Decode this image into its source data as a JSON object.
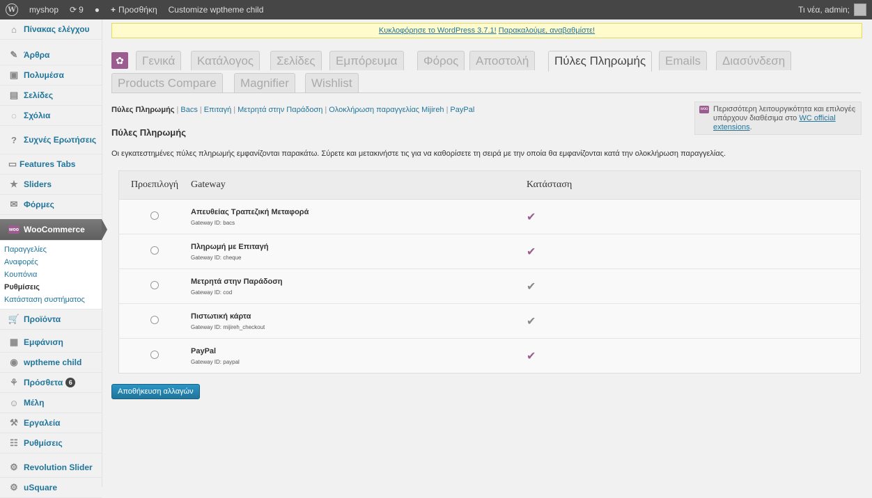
{
  "adminbar": {
    "site_name": "myshop",
    "updates_count": "9",
    "new_label": "Προσθήκη",
    "customize_label": "Customize wptheme child",
    "greeting": "Τι νέα, admin;"
  },
  "sidebar": {
    "items": [
      {
        "label": "Πίνακας ελέγχου",
        "icon": "home-icon"
      },
      {
        "label": "Άρθρα",
        "icon": "pin-icon"
      },
      {
        "label": "Πολυμέσα",
        "icon": "media-icon"
      },
      {
        "label": "Σελίδες",
        "icon": "pages-icon"
      },
      {
        "label": "Σχόλια",
        "icon": "comments-icon"
      },
      {
        "label": "Συχνές Ερωτήσεις",
        "icon": "faq-icon"
      },
      {
        "label": "Features Tabs",
        "icon": "tabs-icon"
      },
      {
        "label": "Sliders",
        "icon": "star-icon"
      },
      {
        "label": "Φόρμες",
        "icon": "mail-icon"
      },
      {
        "label": "WooCommerce",
        "icon": "woo-icon"
      },
      {
        "label": "Προϊόντα",
        "icon": "cart-icon"
      },
      {
        "label": "Εμφάνιση",
        "icon": "appearance-icon"
      },
      {
        "label": "wptheme child",
        "icon": "theme-icon"
      },
      {
        "label": "Πρόσθετα",
        "icon": "plugin-icon",
        "badge": "6"
      },
      {
        "label": "Μέλη",
        "icon": "users-icon"
      },
      {
        "label": "Εργαλεία",
        "icon": "tools-icon"
      },
      {
        "label": "Ρυθμίσεις",
        "icon": "settings-icon"
      },
      {
        "label": "Revolution Slider",
        "icon": "gear-icon"
      },
      {
        "label": "uSquare",
        "icon": "gear-icon"
      }
    ],
    "woo_submenu": [
      "Παραγγελίες",
      "Αναφορές",
      "Κουπόνια",
      "Ρυθμίσεις",
      "Κατάσταση συστήματος"
    ]
  },
  "notice": {
    "text": "Κυκλοφόρησε το WordPress 3.7.1!",
    "link": "Παρακαλούμε, αναβαθμίστε!"
  },
  "tabs": {
    "row1": [
      "Γενικά",
      "Κατάλογος",
      "Σελίδες",
      "Εμπόρευμα",
      "Φόρος",
      "Αποστολή",
      "Πύλες Πληρωμής",
      "Emails",
      "Διασύνδεση"
    ],
    "row2": [
      "Products Compare",
      "Magnifier",
      "Wishlist"
    ],
    "active": "Πύλες Πληρωμής"
  },
  "subsub": {
    "current": "Πύλες Πληρωμής",
    "links": [
      "Bacs",
      "Επιταγή",
      "Μετρητά στην Παράδοση",
      "Ολοκλήρωση παραγγελίας Mijireh",
      "PayPal"
    ]
  },
  "promo": {
    "text": "Περισσότερη λειτουργικότητα και επιλογές υπάρχουν διαθέσιμα στο",
    "link": "WC official extensions",
    "end": "."
  },
  "section": {
    "title": "Πύλες Πληρωμής",
    "description": "Οι εγκατεστημένες πύλες πληρωμής εμφανίζονται παρακάτω. Σύρετε και μετακινήστε τις για να καθορίσετε τη σειρά με την οποία θα εμφανίζονται κατά την ολοκλήρωση παραγγελίας."
  },
  "table": {
    "headers": [
      "Προεπιλογή",
      "Gateway",
      "Κατάσταση"
    ],
    "rows": [
      {
        "name": "Απευθείας Τραπεζική Μεταφορά",
        "id": "Gateway ID: bacs",
        "enabled": true
      },
      {
        "name": "Πληρωμή με Επιταγή",
        "id": "Gateway ID: cheque",
        "enabled": true
      },
      {
        "name": "Μετρητά στην Παράδοση",
        "id": "Gateway ID: cod",
        "enabled": false
      },
      {
        "name": "Πιστωτική κάρτα",
        "id": "Gateway ID: mijireh_checkout",
        "enabled": false
      },
      {
        "name": "PayPal",
        "id": "Gateway ID: paypal",
        "enabled": true
      }
    ]
  },
  "save_label": "Αποθήκευση αλλαγών",
  "colors": {
    "accent": "#9b5c8f",
    "link": "#21759b",
    "check_enabled": "#9b5c8f",
    "check_disabled": "#888888"
  }
}
